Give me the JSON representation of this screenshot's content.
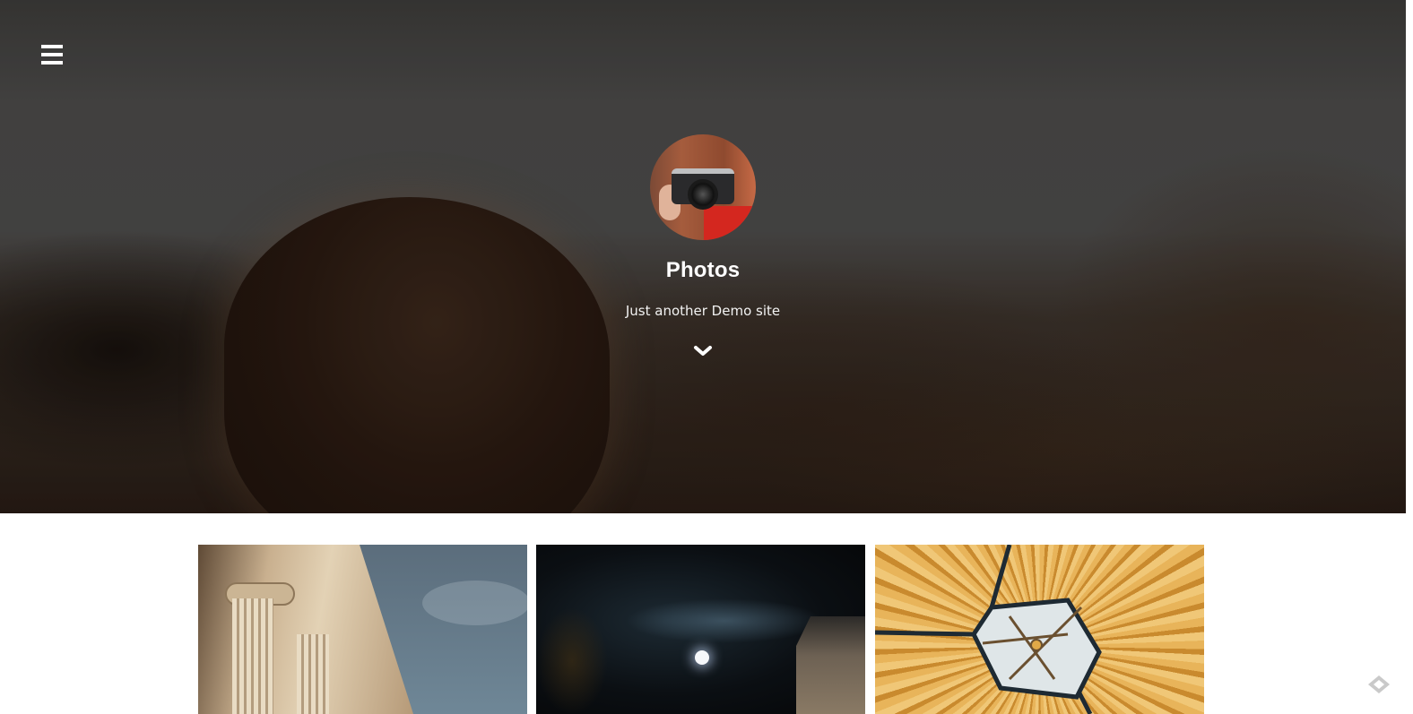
{
  "header": {
    "menu_icon": "hamburger-menu-icon",
    "site_title": "Photos",
    "tagline": "Just another Demo site",
    "scroll_icon": "chevron-down-icon",
    "avatar_alt": "avatar"
  },
  "gallery": {
    "tiles": [
      {
        "subject": "columns"
      },
      {
        "subject": "moon"
      },
      {
        "subject": "umbrella"
      }
    ]
  },
  "footer": {
    "icon": "feedly-icon"
  },
  "colors": {
    "text_on_hero": "#ffffff",
    "page_background": "#ffffff"
  }
}
